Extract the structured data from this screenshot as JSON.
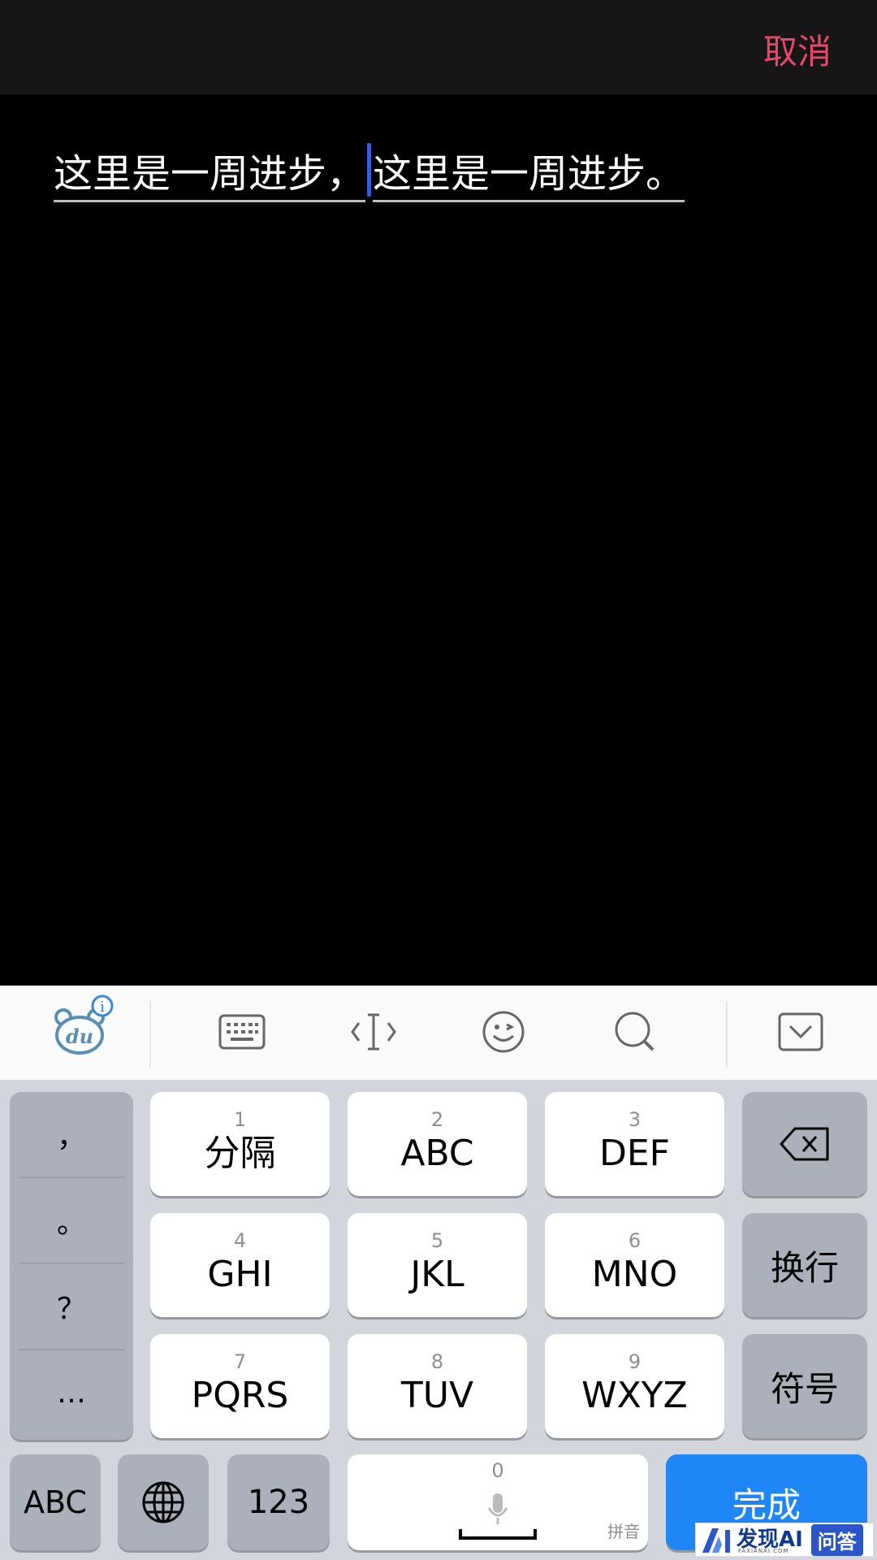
{
  "topbar": {
    "cancel_label": "取消"
  },
  "editor": {
    "text_before_caret": "这里是一周进步，",
    "text_after_caret": "这里是一周进步。"
  },
  "keyboard_toolbar": {
    "icons": [
      "baidu-du-logo-icon",
      "keyboard-icon",
      "cursor-move-icon",
      "emoji-icon",
      "search-icon",
      "hide-keyboard-icon"
    ]
  },
  "keyboard": {
    "punctuation": [
      "，",
      "。",
      "？",
      "…"
    ],
    "keys": [
      {
        "num": "1",
        "label": "分隔"
      },
      {
        "num": "2",
        "label": "ABC"
      },
      {
        "num": "3",
        "label": "DEF"
      },
      {
        "num": "4",
        "label": "GHI"
      },
      {
        "num": "5",
        "label": "JKL"
      },
      {
        "num": "6",
        "label": "MNO"
      },
      {
        "num": "7",
        "label": "PQRS"
      },
      {
        "num": "8",
        "label": "TUV"
      },
      {
        "num": "9",
        "label": "WXYZ"
      }
    ],
    "newline_label": "换行",
    "symbols_label": "符号",
    "abc_label": "ABC",
    "numeric_label": "123",
    "space_num": "0",
    "space_hint": "拼音",
    "done_label": "完成"
  },
  "watermark": {
    "brand": "发现AI",
    "sub": "FAXIANAI.COM",
    "badge": "问答"
  }
}
